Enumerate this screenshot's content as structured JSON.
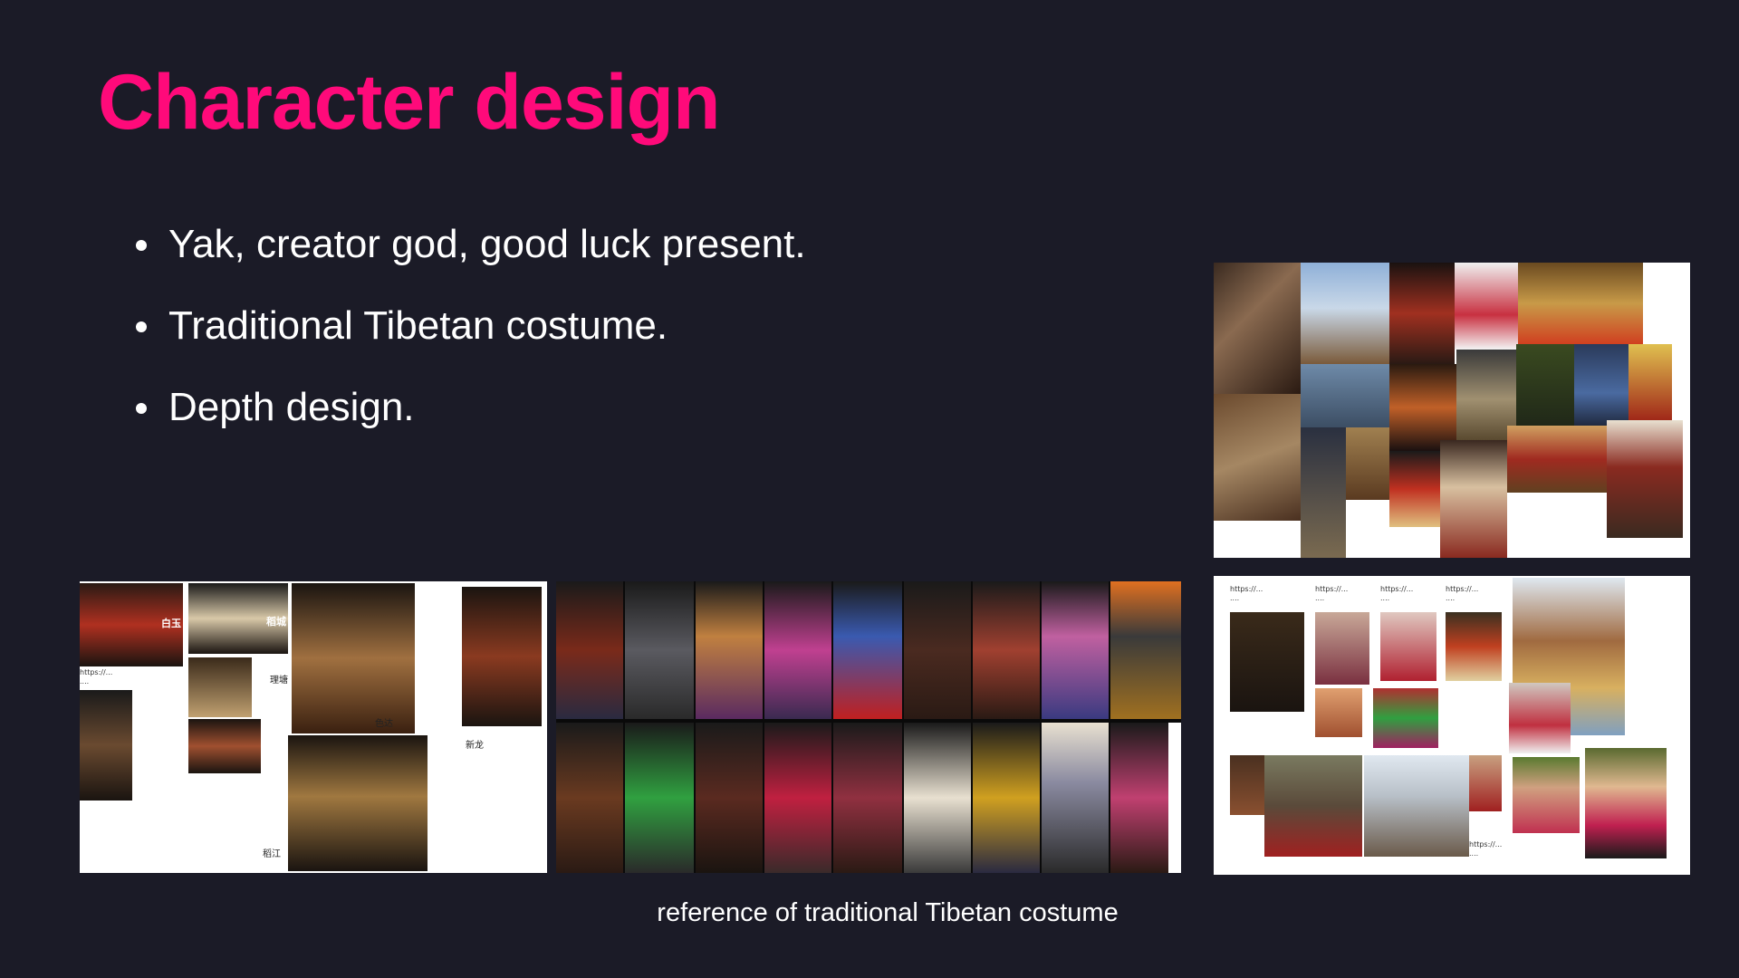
{
  "slide": {
    "title": "Character design",
    "bullets": [
      "Yak, creator god, good luck present.",
      "Traditional Tibetan costume.",
      "Depth design."
    ],
    "caption": "reference of traditional Tibetan costume"
  },
  "collage_left": {
    "region_labels": [
      "理塘",
      "色达",
      "新龙",
      "稻江"
    ],
    "brand_labels": [
      "白玉",
      "稻城"
    ]
  },
  "colors": {
    "background": "#1b1b27",
    "title": "#ff0a7a",
    "text": "#ffffff"
  }
}
